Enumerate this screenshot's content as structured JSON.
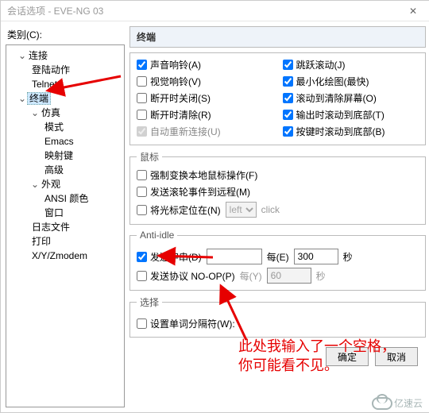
{
  "title": "会话选项 - EVE-NG 03",
  "categoryLabel": "类别(C):",
  "tree": {
    "n0": "连接",
    "n01": "登陆动作",
    "n02": "Telnet",
    "n1": "终端",
    "n11": "仿真",
    "n111": "模式",
    "n112": "Emacs",
    "n113": "映射键",
    "n114": "高级",
    "n12": "外观",
    "n121": "ANSI 颜色",
    "n122": "窗口",
    "n13": "日志文件",
    "n14": "打印",
    "n15": "X/Y/Zmodem"
  },
  "panelHeader": "终端",
  "top": {
    "c1": "声音响铃(A)",
    "c2": "视觉响铃(V)",
    "c3": "断开时关闭(S)",
    "c4": "断开时清除(R)",
    "c5": "自动重新连接(U)",
    "r1": "跳跃滚动(J)",
    "r2": "最小化绘图(最快)",
    "r3": "滚动到清除屏幕(O)",
    "r4": "输出时滚动到底部(T)",
    "r5": "按键时滚动到底部(B)"
  },
  "mouse": {
    "legend": "鼠标",
    "m1": "强制变换本地鼠标操作(F)",
    "m2": "发送滚轮事件到远程(M)",
    "m3": "将光标定位在(N)",
    "sel": "left",
    "click": "click"
  },
  "anti": {
    "legend": "Anti-idle",
    "a1": "发送字串(D)",
    "val1": "",
    "every": "每(E)",
    "int1": "300",
    "sec": "秒",
    "a2": "发送协议 NO-OP(P)",
    "everyY": "每(Y)",
    "int2": "60"
  },
  "sel": {
    "legend": "选择",
    "s1": "设置单词分隔符(W):"
  },
  "buttons": {
    "ok": "确定",
    "cancel": "取消"
  },
  "annot": {
    "l1": "此处我输入了一个空格，",
    "l2": "你可能看不见。"
  },
  "watermark": "亿速云"
}
